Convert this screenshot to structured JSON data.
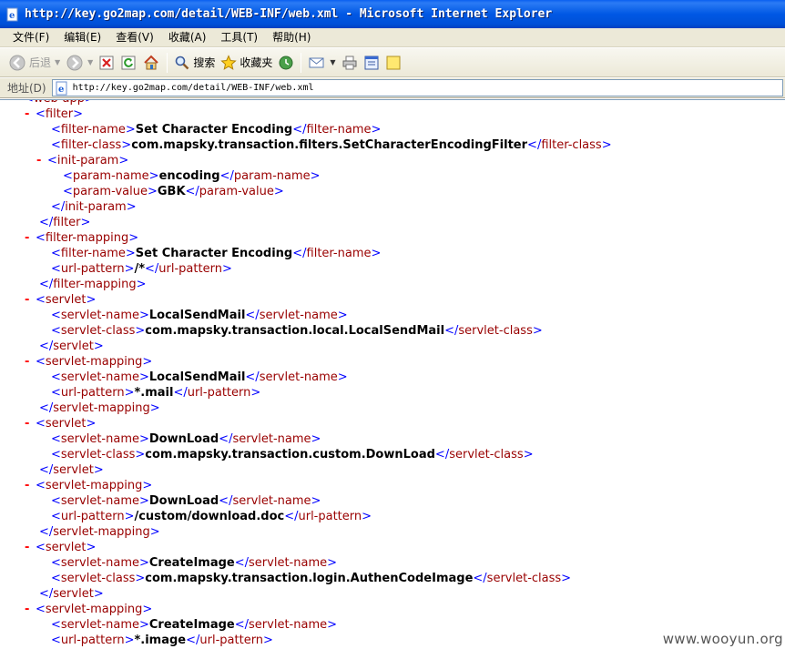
{
  "window": {
    "title": "http://key.go2map.com/detail/WEB-INF/web.xml - Microsoft Internet Explorer"
  },
  "menu": [
    {
      "label": "文件(F)"
    },
    {
      "label": "编辑(E)"
    },
    {
      "label": "查看(V)"
    },
    {
      "label": "收藏(A)"
    },
    {
      "label": "工具(T)"
    },
    {
      "label": "帮助(H)"
    }
  ],
  "toolbar": {
    "back_label": "后退",
    "search_label": "搜索",
    "favorites_label": "收藏夹"
  },
  "address": {
    "label": "地址(D)",
    "url": "http://key.go2map.com/detail/WEB-INF/web.xml"
  },
  "xml_lines": [
    {
      "toggle": "-",
      "open": "web-app",
      "text": "",
      "close": ""
    },
    {
      "toggle": "-",
      "open": "filter",
      "text": "",
      "close": ""
    },
    {
      "toggle": "",
      "open": "filter-name",
      "text": "Set Character Encoding",
      "close": "filter-name"
    },
    {
      "toggle": "",
      "open": "filter-class",
      "text": "com.mapsky.transaction.filters.SetCharacterEncodingFilter",
      "close": "filter-class"
    },
    {
      "toggle": "-",
      "open": "init-param",
      "text": "",
      "close": ""
    },
    {
      "toggle": "",
      "open": "param-name",
      "text": "encoding",
      "close": "param-name"
    },
    {
      "toggle": "",
      "open": "param-value",
      "text": "GBK",
      "close": "param-value"
    },
    {
      "toggle": "",
      "open": "",
      "text": "",
      "close": "init-param"
    },
    {
      "toggle": "",
      "open": "",
      "text": "",
      "close": "filter"
    },
    {
      "toggle": "-",
      "open": "filter-mapping",
      "text": "",
      "close": ""
    },
    {
      "toggle": "",
      "open": "filter-name",
      "text": "Set Character Encoding",
      "close": "filter-name"
    },
    {
      "toggle": "",
      "open": "url-pattern",
      "text": "/*",
      "close": "url-pattern"
    },
    {
      "toggle": "",
      "open": "",
      "text": "",
      "close": "filter-mapping"
    },
    {
      "toggle": "-",
      "open": "servlet",
      "text": "",
      "close": ""
    },
    {
      "toggle": "",
      "open": "servlet-name",
      "text": "LocalSendMail",
      "close": "servlet-name"
    },
    {
      "toggle": "",
      "open": "servlet-class",
      "text": "com.mapsky.transaction.local.LocalSendMail",
      "close": "servlet-class"
    },
    {
      "toggle": "",
      "open": "",
      "text": "",
      "close": "servlet"
    },
    {
      "toggle": "-",
      "open": "servlet-mapping",
      "text": "",
      "close": ""
    },
    {
      "toggle": "",
      "open": "servlet-name",
      "text": "LocalSendMail",
      "close": "servlet-name"
    },
    {
      "toggle": "",
      "open": "url-pattern",
      "text": "*.mail",
      "close": "url-pattern"
    },
    {
      "toggle": "",
      "open": "",
      "text": "",
      "close": "servlet-mapping"
    },
    {
      "toggle": "-",
      "open": "servlet",
      "text": "",
      "close": ""
    },
    {
      "toggle": "",
      "open": "servlet-name",
      "text": "DownLoad",
      "close": "servlet-name"
    },
    {
      "toggle": "",
      "open": "servlet-class",
      "text": "com.mapsky.transaction.custom.DownLoad",
      "close": "servlet-class"
    },
    {
      "toggle": "",
      "open": "",
      "text": "",
      "close": "servlet"
    },
    {
      "toggle": "-",
      "open": "servlet-mapping",
      "text": "",
      "close": ""
    },
    {
      "toggle": "",
      "open": "servlet-name",
      "text": "DownLoad",
      "close": "servlet-name"
    },
    {
      "toggle": "",
      "open": "url-pattern",
      "text": "/custom/download.doc",
      "close": "url-pattern"
    },
    {
      "toggle": "",
      "open": "",
      "text": "",
      "close": "servlet-mapping"
    },
    {
      "toggle": "-",
      "open": "servlet",
      "text": "",
      "close": ""
    },
    {
      "toggle": "",
      "open": "servlet-name",
      "text": "CreateImage",
      "close": "servlet-name"
    },
    {
      "toggle": "",
      "open": "servlet-class",
      "text": "com.mapsky.transaction.login.AuthenCodeImage",
      "close": "servlet-class"
    },
    {
      "toggle": "",
      "open": "",
      "text": "",
      "close": "servlet"
    },
    {
      "toggle": "-",
      "open": "servlet-mapping",
      "text": "",
      "close": ""
    },
    {
      "toggle": "",
      "open": "servlet-name",
      "text": "CreateImage",
      "close": "servlet-name"
    },
    {
      "toggle": "",
      "open": "url-pattern",
      "text": "*.image",
      "close": "url-pattern"
    }
  ],
  "watermark": "www.wooyun.org"
}
